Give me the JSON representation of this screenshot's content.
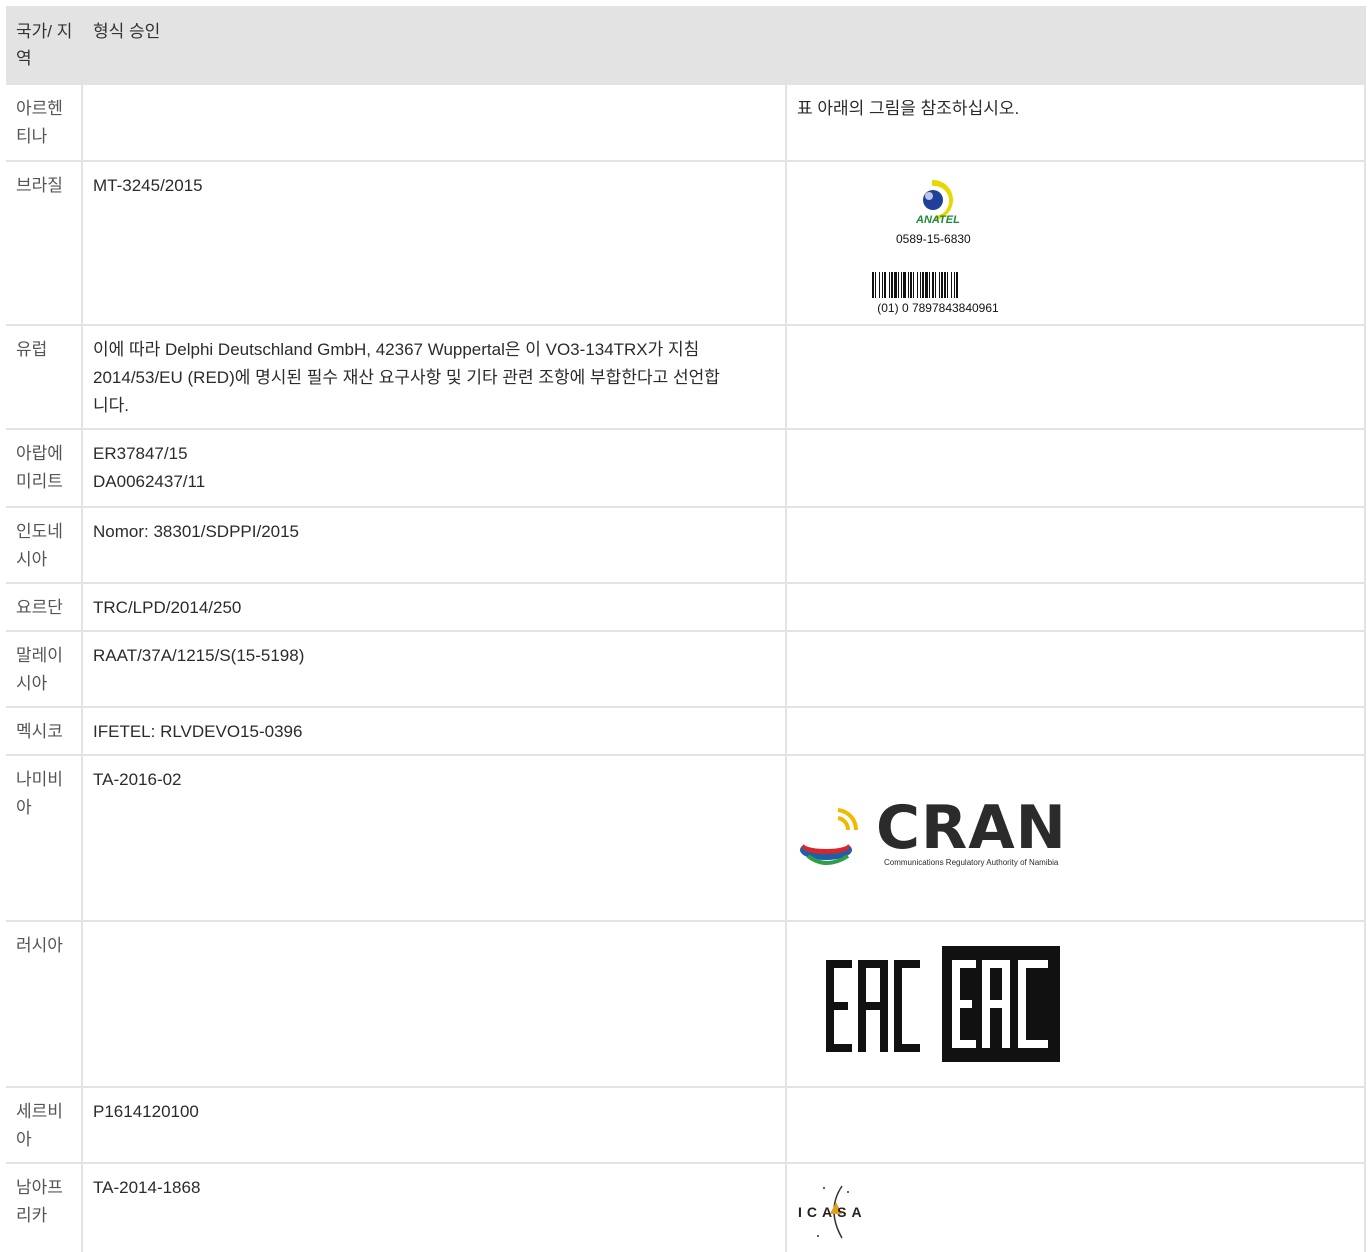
{
  "header": {
    "country": "국가/ 지역",
    "approval": "형식 승인"
  },
  "rows": [
    {
      "country": "아르헨티나",
      "approval": [],
      "mark_text": "표 아래의 그림을 참조하십시오."
    },
    {
      "country": "브라질",
      "approval": [
        "MT-3245/2015"
      ],
      "mark": {
        "brand": "ANATEL",
        "code": "0589-15-6830",
        "barcode": "(01) 0 7897843840961"
      }
    },
    {
      "country": "유럽",
      "approval": [
        "이에 따라 Delphi Deutschland GmbH, 42367 Wuppertal은 이 VO3-134TRX가 지침",
        "2014/53/EU (RED)에 명시된 필수 재산 요구사항 및 기타 관련 조항에 부합한다고 선언합",
        "니다."
      ]
    },
    {
      "country": "아랍에미리트",
      "approval": [
        "ER37847/15",
        "DA0062437/11"
      ]
    },
    {
      "country": "인도네시아",
      "approval": [
        "Nomor: 38301/SDPPI/2015"
      ]
    },
    {
      "country": "요르단",
      "approval": [
        "TRC/LPD/2014/250"
      ]
    },
    {
      "country": "말레이시아",
      "approval": [
        "RAAT/37A/1215/S(15-5198)"
      ]
    },
    {
      "country": "멕시코",
      "approval": [
        "IFETEL: RLVDEVO15-0396"
      ]
    },
    {
      "country": "나미비아",
      "approval": [
        "TA-2016-02"
      ],
      "mark": {
        "brand": "CRAN",
        "subtitle": "Communications Regulatory Authority of Namibia"
      }
    },
    {
      "country": "러시아",
      "approval": [],
      "mark": {
        "brand": "EAC"
      }
    },
    {
      "country": "세르비아",
      "approval": [
        "P1614120100"
      ]
    },
    {
      "country": "남아프리카",
      "approval": [
        "TA-2014-1868"
      ],
      "mark": {
        "brand": "ICASA"
      }
    }
  ],
  "colors": {
    "header_bg": "#e3e3e3",
    "anatel_yellow": "#e6d800",
    "anatel_blue": "#1f3f9a",
    "anatel_green": "#1e8a3c"
  }
}
